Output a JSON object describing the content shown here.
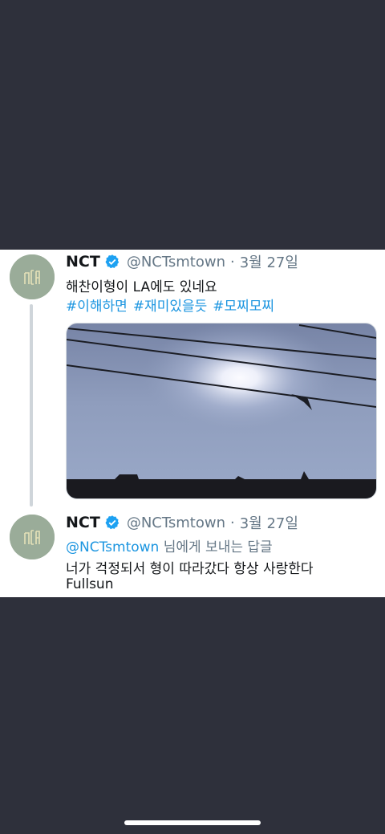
{
  "tweet1": {
    "name": "NCT",
    "handle": "@NCTsmtown",
    "separator": "·",
    "date": "3월 27일",
    "text": "해찬이형이 LA에도 있네요",
    "hashtags": [
      "#이해하면",
      "#재미있을듯",
      "#모찌모찌"
    ]
  },
  "tweet2": {
    "name": "NCT",
    "handle": "@NCTsmtown",
    "separator": "·",
    "date": "3월 27일",
    "reply_to": "@NCTsmtown",
    "reply_suffix": " 님에게 보내는 답글",
    "text_line1": "너가 걱정되서 형이 따라갔다 항상 사랑한다",
    "text_line2": "Fullsun"
  },
  "colors": {
    "background": "#2e303b",
    "card": "#ffffff",
    "link": "#1b95e0",
    "muted": "#657786",
    "verified": "#1da1f2",
    "avatar": "#9aac99"
  },
  "icons": [
    "nct-logo-avatar",
    "verified-badge-icon"
  ]
}
